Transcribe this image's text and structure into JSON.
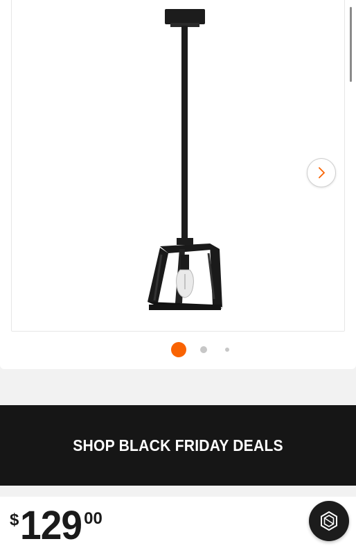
{
  "gallery": {
    "product_image": "pendant-light-icon",
    "next_icon": "chevron-right-icon",
    "dots_count": 3,
    "active_dot": 1
  },
  "promo": {
    "label": "SHOP BLACK FRIDAY DEALS"
  },
  "price": {
    "currency": "$",
    "dollars": "129",
    "cents": "00"
  },
  "chat": {
    "icon": "hexagon-chat-icon"
  },
  "colors": {
    "accent": "#f96302",
    "banner_bg": "#161616",
    "text": "#1a1a1a"
  }
}
